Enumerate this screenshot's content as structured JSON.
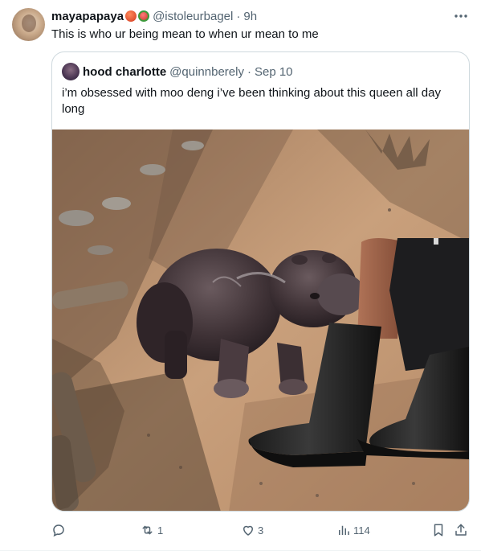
{
  "tweet": {
    "author_name": "mayapapaya",
    "author_handle": "@istoleurbagel",
    "separator": "·",
    "time": "9h",
    "text": "This is who ur being mean to when ur mean to me",
    "more_icon": "more-horizontal-icon"
  },
  "quote": {
    "author_name": "hood charlotte",
    "author_handle": "@quinnberely",
    "separator": "·",
    "date": "Sep 10",
    "text": "i’m obsessed with moo deng i’ve been thinking about this queen all day long",
    "image_alt": "baby pygmy hippo nuzzling a person's leg in a black rubber boot on sandy dirt ground"
  },
  "actions": {
    "reply": {
      "icon": "reply-icon",
      "count": ""
    },
    "retweet": {
      "icon": "retweet-icon",
      "count": "1"
    },
    "like": {
      "icon": "heart-icon",
      "count": "3"
    },
    "views": {
      "icon": "views-icon",
      "count": "114"
    },
    "bookmark": {
      "icon": "bookmark-icon"
    },
    "share": {
      "icon": "share-icon"
    }
  },
  "colors": {
    "text_primary": "#0f1419",
    "text_secondary": "#536471",
    "border": "#cfd9de"
  }
}
